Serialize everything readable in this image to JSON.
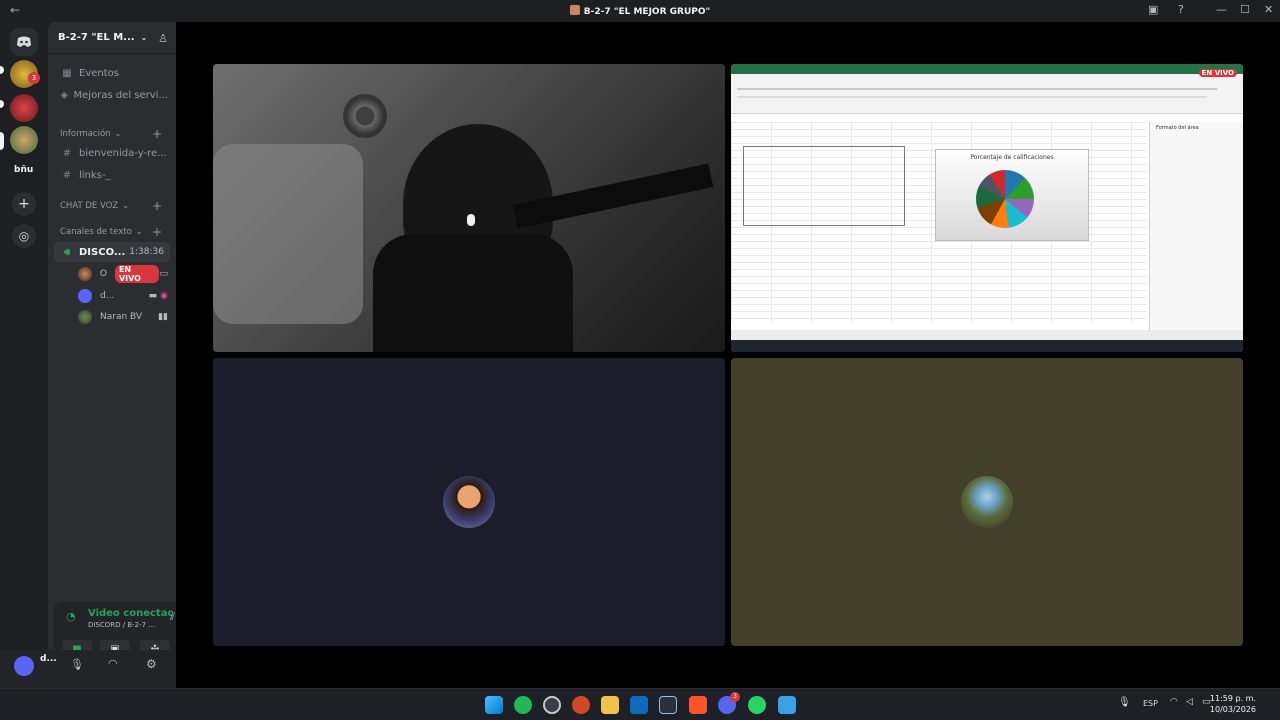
{
  "window": {
    "title": "B-2-7 \"EL MEJOR GRUPO\"",
    "back_glyph": "←",
    "inbox_glyph": "▣",
    "help_glyph": "?",
    "minimize_glyph": "—",
    "maximize_glyph": "☐",
    "close_glyph": "✕"
  },
  "server_rail": {
    "badge_count": "3",
    "text_server_label": "bñu",
    "add_glyph": "+",
    "discover_glyph": "◎"
  },
  "sidebar": {
    "server_name": "B-2-7 \"EL M...",
    "caret": "⌄",
    "events": "Eventos",
    "boosts": "Mejoras del servi...",
    "category_info": "Información",
    "channel_1": "bienvenida-y-re...",
    "channel_2": "links-_",
    "category_voice": "CHAT DE VOZ",
    "category_text": "Canales de texto",
    "voice_channel": "DISCO...",
    "voice_time": "1:38:36",
    "member_1": "O",
    "member_1_badge": "EN VIVO",
    "member_2": "d...",
    "member_3": "Naran BV"
  },
  "voice_panel": {
    "status": "Video conectac",
    "sub": "DISCORD / B-2-7 ..."
  },
  "user_panel": {
    "name": "d..."
  },
  "excel_stream": {
    "live_badge": "EN VIVO",
    "chart_title": "Porcentaje de calificaciones",
    "side_panel_title": "Formato del área"
  },
  "taskbar": {
    "lang": "ESP",
    "time": "11:59 p. m.",
    "date": "10/03/2026",
    "discord_badge": "3"
  },
  "colors": {
    "discord_bg": "#1e1f22",
    "sidebar_bg": "#2b2d31",
    "green": "#23a55a",
    "live_red": "#da373c",
    "excel_green": "#217346"
  }
}
